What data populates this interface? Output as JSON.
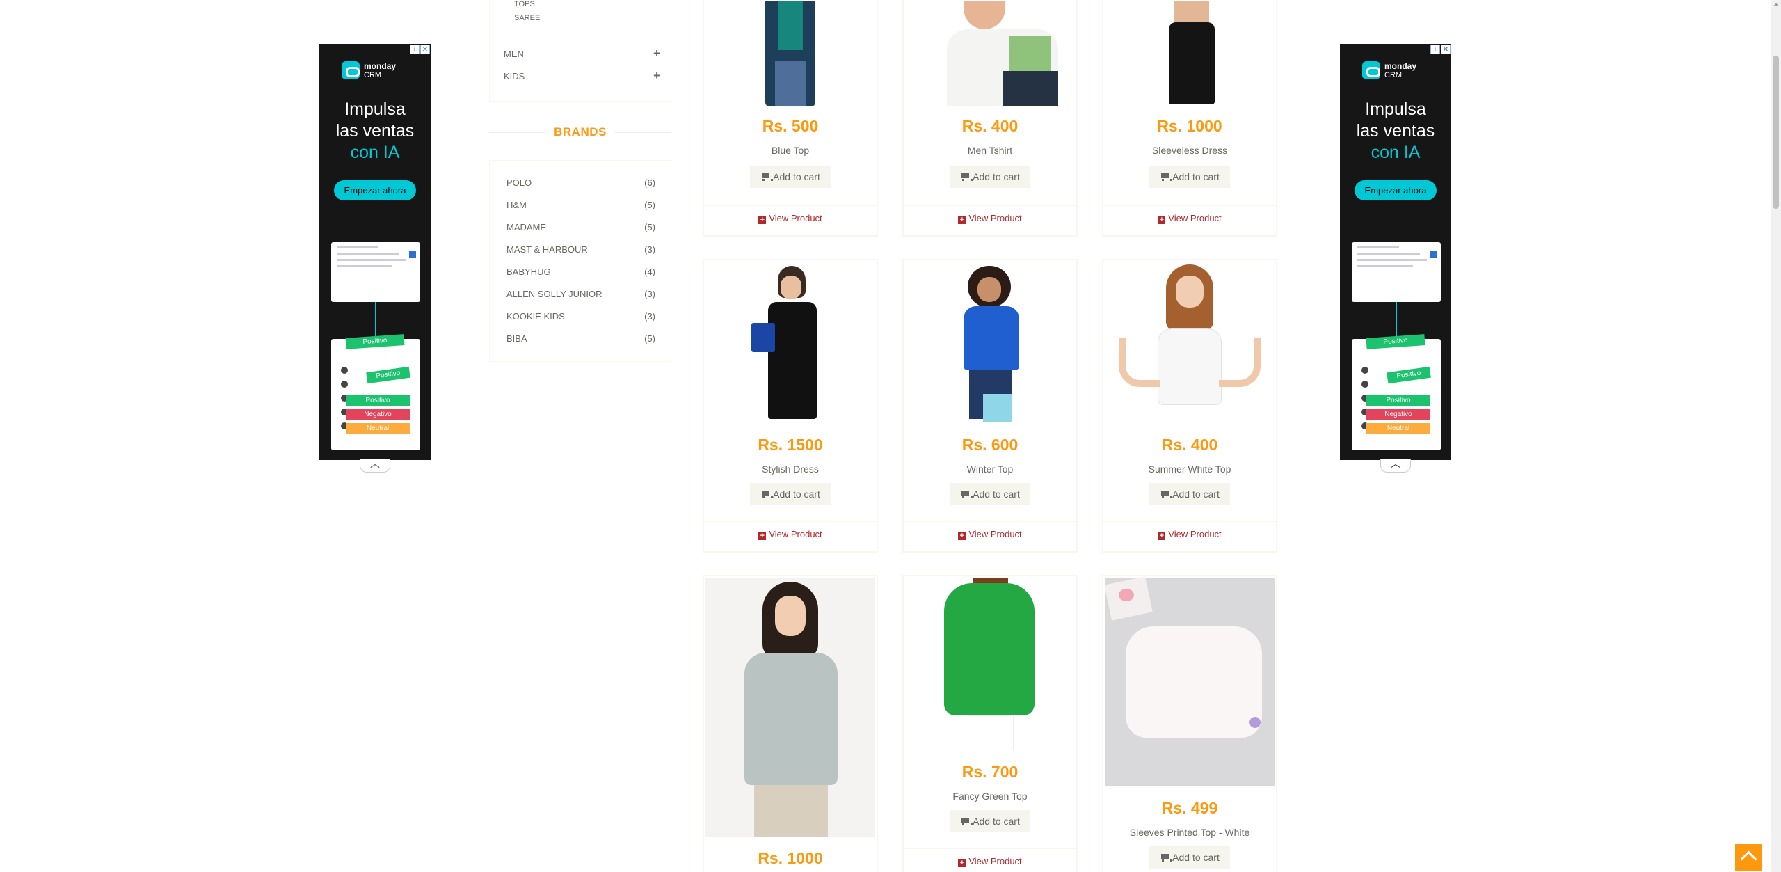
{
  "categories": {
    "women_subitems": [
      "TOPS",
      "SAREE"
    ],
    "items": [
      {
        "label": "MEN",
        "icon": "plus-icon"
      },
      {
        "label": "KIDS",
        "icon": "plus-icon"
      }
    ]
  },
  "brands": {
    "title": "BRANDS",
    "items": [
      {
        "name": "POLO",
        "count": "(6)"
      },
      {
        "name": "H&M",
        "count": "(5)"
      },
      {
        "name": "MADAME",
        "count": "(5)"
      },
      {
        "name": "MAST & HARBOUR",
        "count": "(3)"
      },
      {
        "name": "BABYHUG",
        "count": "(4)"
      },
      {
        "name": "ALLEN SOLLY JUNIOR",
        "count": "(3)"
      },
      {
        "name": "KOOKIE KIDS",
        "count": "(3)"
      },
      {
        "name": "BIBA",
        "count": "(5)"
      }
    ]
  },
  "products": [
    {
      "price": "Rs. 500",
      "name": "Blue Top",
      "cart": "Add to cart",
      "view": "View Product"
    },
    {
      "price": "Rs. 400",
      "name": "Men Tshirt",
      "cart": "Add to cart",
      "view": "View Product"
    },
    {
      "price": "Rs. 1000",
      "name": "Sleeveless Dress",
      "cart": "Add to cart",
      "view": "View Product"
    },
    {
      "price": "Rs. 1500",
      "name": "Stylish Dress",
      "cart": "Add to cart",
      "view": "View Product"
    },
    {
      "price": "Rs. 600",
      "name": "Winter Top",
      "cart": "Add to cart",
      "view": "View Product"
    },
    {
      "price": "Rs. 400",
      "name": "Summer White Top",
      "cart": "Add to cart",
      "view": "View Product"
    },
    {
      "price": "Rs. 1000",
      "name": "",
      "cart": "",
      "view": ""
    },
    {
      "price": "Rs. 700",
      "name": "Fancy Green Top",
      "cart": "Add to cart",
      "view": "View Product"
    },
    {
      "price": "Rs. 499",
      "name": "Sleeves Printed Top - White",
      "cart": "Add to cart",
      "view": ""
    }
  ],
  "ad": {
    "brand_name": "monday",
    "brand_sub": "CRM",
    "headline_1": "Impulsa",
    "headline_2": "las ventas",
    "headline_3": "con IA",
    "cta": "Empezar ahora",
    "pill_1": "Positivo",
    "pill_2": "Positivo",
    "status_1": "Positivo",
    "status_2": "Negativo",
    "status_3": "Neutral",
    "accent_color": "#00c8d4"
  },
  "colors": {
    "price": "#fe980f",
    "view_link": "#b3282d",
    "text": "#696763"
  }
}
